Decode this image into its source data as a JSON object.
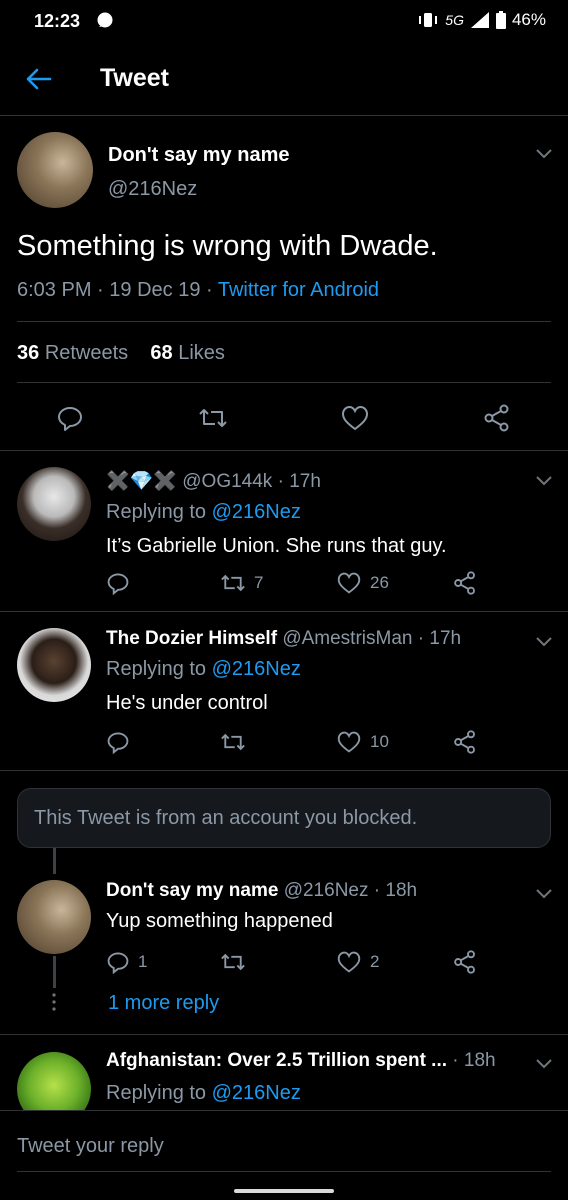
{
  "status": {
    "time": "12:23",
    "network": "5G",
    "battery": "46%"
  },
  "header": {
    "title": "Tweet"
  },
  "main_tweet": {
    "name": "Don't say my name",
    "handle": "@216Nez",
    "text": "Something is wrong with Dwade.",
    "time": "6:03 PM",
    "date": "19 Dec 19",
    "source": "Twitter for Android",
    "retweets": "36",
    "retweets_label": "Retweets",
    "likes": "68",
    "likes_label": "Likes"
  },
  "replies": [
    {
      "name_prefix": "✖️💎✖️",
      "handle": "@OG144k",
      "time": "17h",
      "reply_to_label": "Replying to",
      "reply_to": "@216Nez",
      "text": "It’s Gabrielle Union. She runs that guy.",
      "retweets": "7",
      "likes": "26"
    },
    {
      "name": "The Dozier Himself",
      "handle": "@AmestrisMan",
      "time": "17h",
      "reply_to_label": "Replying to",
      "reply_to": "@216Nez",
      "text": "He's under control",
      "retweets": "",
      "likes": "10"
    }
  ],
  "blocked": {
    "text": "This Tweet is from an account you blocked."
  },
  "thread_reply": {
    "name": "Don't say my name",
    "handle": "@216Nez",
    "time": "18h",
    "text": "Yup something happened",
    "replies": "1",
    "likes": "2",
    "more_label": "1 more reply"
  },
  "last_reply": {
    "name": "Afghanistan: Over 2.5 Trillion spent ...",
    "time": "18h",
    "reply_to_label": "Replying to",
    "reply_to": "@216Nez"
  },
  "compose": {
    "placeholder": "Tweet your reply"
  },
  "colors": {
    "background": "#000000",
    "accent": "#1d9bf0",
    "muted": "#8b98a5",
    "divider": "#2f3336"
  }
}
